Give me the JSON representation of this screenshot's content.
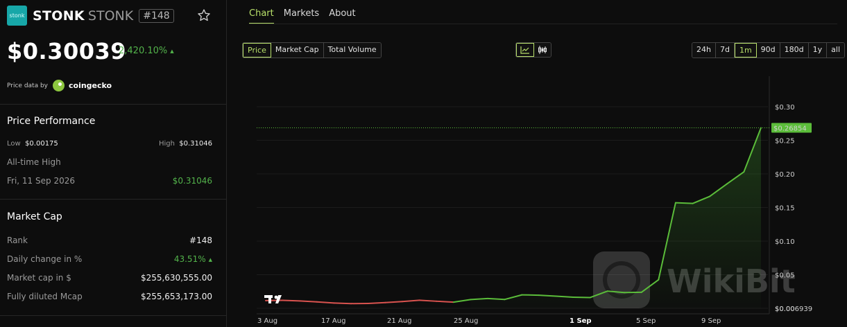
{
  "coin": {
    "logo_text": "stonk",
    "name": "STONK",
    "ticker": "STONK",
    "rank_badge": "#148",
    "price": "$0.30039",
    "change": "2,420.10%",
    "price_data_label": "Price data by",
    "price_data_source": "coingecko"
  },
  "performance": {
    "title": "Price Performance",
    "low_label": "Low",
    "low_value": "$0.00175",
    "high_label": "High",
    "high_value": "$0.31046",
    "ath_label": "All-time High",
    "ath_date": "Fri, 11 Sep 2026",
    "ath_value": "$0.31046"
  },
  "market_cap": {
    "title": "Market Cap",
    "rows": [
      {
        "label": "Rank",
        "value": "#148"
      },
      {
        "label": "Daily change in %",
        "value": "43.51%"
      },
      {
        "label": "Market cap in $",
        "value": "$255,630,555.00"
      },
      {
        "label": "Fully diluted Mcap",
        "value": "$255,653,173.00"
      }
    ]
  },
  "tabs": [
    "Chart",
    "Markets",
    "About"
  ],
  "metric_buttons": [
    "Price",
    "Market Cap",
    "Total Volume"
  ],
  "range_buttons": [
    "24h",
    "7d",
    "1m",
    "90d",
    "180d",
    "1y",
    "all"
  ],
  "colors": {
    "accent": "#b8e06a",
    "up": "#53b34b",
    "down": "#d9534f",
    "price_line": "#5bbd3a"
  },
  "chart_data": {
    "type": "line",
    "x_ticks": [
      "3 Aug",
      "17 Aug",
      "21 Aug",
      "25 Aug",
      "1 Sep",
      "5 Sep",
      "9 Sep"
    ],
    "y_ticks": [
      "$0.30",
      "$0.25",
      "$0.20",
      "$0.15",
      "$0.10",
      "$0.05",
      "$0.00"
    ],
    "ylim": [
      0,
      0.335
    ],
    "current_label": "$0.26854",
    "current_value": 0.26854,
    "bottom_label": "$0.006939",
    "watermark": "WikiBit",
    "series": [
      {
        "values": [
          {
            "x": 0,
            "y": 0.0115
          },
          {
            "x": 1,
            "y": 0.0118
          },
          {
            "x": 2,
            "y": 0.011
          },
          {
            "x": 3,
            "y": 0.0095
          },
          {
            "x": 4,
            "y": 0.0078
          },
          {
            "x": 5,
            "y": 0.007
          },
          {
            "x": 6,
            "y": 0.0072
          },
          {
            "x": 7,
            "y": 0.0085
          },
          {
            "x": 8,
            "y": 0.01
          },
          {
            "x": 9,
            "y": 0.012
          },
          {
            "x": 10,
            "y": 0.0105
          },
          {
            "x": 11,
            "y": 0.0092
          },
          {
            "x": 12,
            "y": 0.013
          },
          {
            "x": 13,
            "y": 0.0145
          },
          {
            "x": 14,
            "y": 0.0132
          },
          {
            "x": 15,
            "y": 0.02
          },
          {
            "x": 16,
            "y": 0.0195
          },
          {
            "x": 17,
            "y": 0.018
          },
          {
            "x": 18,
            "y": 0.0165
          },
          {
            "x": 19,
            "y": 0.016
          },
          {
            "x": 20,
            "y": 0.0255
          },
          {
            "x": 21,
            "y": 0.0235
          },
          {
            "x": 22,
            "y": 0.0238
          },
          {
            "x": 23,
            "y": 0.0425
          },
          {
            "x": 24,
            "y": 0.157
          },
          {
            "x": 25,
            "y": 0.156
          },
          {
            "x": 26,
            "y": 0.1665
          },
          {
            "x": 27,
            "y": 0.185
          },
          {
            "x": 28,
            "y": 0.203
          },
          {
            "x": 29,
            "y": 0.2685
          }
        ]
      }
    ]
  }
}
